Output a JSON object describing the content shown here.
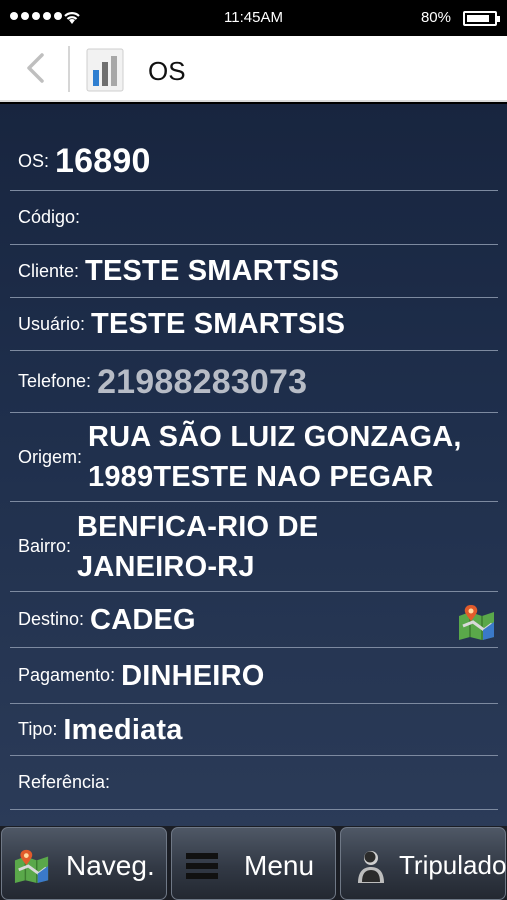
{
  "status": {
    "time": "11:45AM",
    "battery": "80%"
  },
  "header": {
    "title": "OS"
  },
  "fields": [
    {
      "label": "OS:",
      "value": "16890"
    },
    {
      "label": "Código:",
      "value": ""
    },
    {
      "label": "Cliente:",
      "value": "TESTE SMARTSIS"
    },
    {
      "label": "Usuário:",
      "value": "TESTE SMARTSIS"
    },
    {
      "label": "Telefone:",
      "value": "21988283073"
    },
    {
      "label": "Origem:",
      "value_line1": "RUA SÃO LUIZ GONZAGA,",
      "value_line2": "1989TESTE NAO PEGAR"
    },
    {
      "label": "Bairro:",
      "value_line1": "BENFICA-RIO DE",
      "value_line2": "JANEIRO-RJ"
    },
    {
      "label": "Destino:",
      "value": "CADEG",
      "icon": "map-icon"
    },
    {
      "label": "Pagamento:",
      "value": "DINHEIRO"
    },
    {
      "label": "Tipo:",
      "value": "Imediata"
    },
    {
      "label": "Referência:",
      "value": ""
    }
  ],
  "bottom_nav": [
    {
      "label": "Naveg.",
      "icon": "map-icon"
    },
    {
      "label": "Menu",
      "icon": "menu-icon"
    },
    {
      "label": "Tripulado",
      "icon": "person-icon"
    }
  ],
  "colors": {
    "content_bg": "#1e2e4b",
    "header_bg": "#ffffff",
    "status_bg": "#000000",
    "phone_value": "#b7bcc6"
  }
}
